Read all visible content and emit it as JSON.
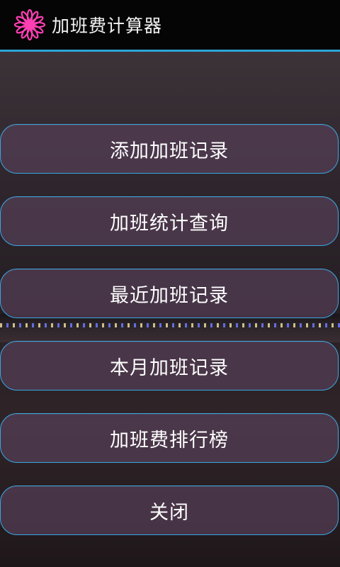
{
  "app": {
    "title": "加班费计算器",
    "icon": "pink-flower-icon",
    "accent_color": "#2ea4d8",
    "icon_color": "#ff3fb4"
  },
  "menu": {
    "items": [
      {
        "label": "添加加班记录"
      },
      {
        "label": "加班统计查询"
      },
      {
        "label": "最近加班记录"
      },
      {
        "label": "本月加班记录"
      },
      {
        "label": "加班费排行榜"
      },
      {
        "label": "关闭"
      }
    ],
    "button_border_color": "#3aa6e6"
  }
}
